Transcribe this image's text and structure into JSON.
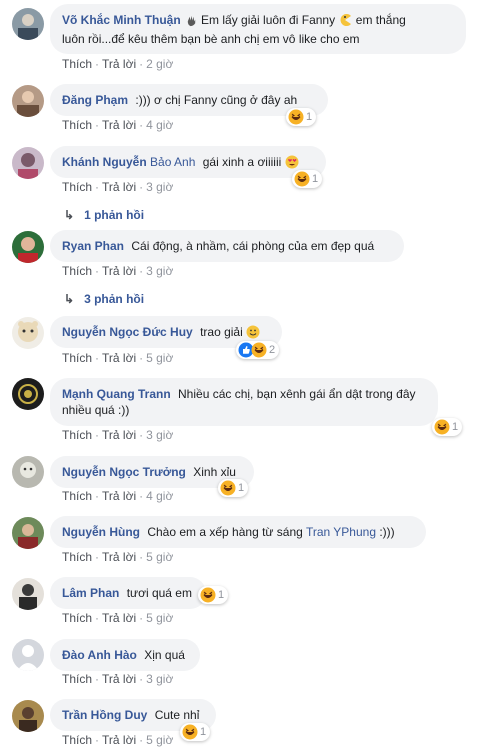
{
  "actions": {
    "like": "Thích",
    "reply": "Trả lời",
    "sep": "·"
  },
  "comments": [
    {
      "author": "Võ Khắc Minh Thuận",
      "text_1": "Em lấy giải luôn đi Fanny",
      "text_2": "em thắng",
      "text_3": "luôn rồi...để kêu thêm bạn bè anh chị em vô like cho em",
      "time": "2 giờ"
    },
    {
      "author": "Đăng Phạm",
      "text": ":))) ơ chị Fanny cũng ở đây ah",
      "time": "4 giờ",
      "reaction_count": "1"
    },
    {
      "author": "Khánh Nguyễn",
      "author_light": "Bảo Anh",
      "text": "gái xinh a ơiiiiii",
      "time": "3 giờ",
      "reaction_count": "1",
      "replies": "1 phản hồi"
    },
    {
      "author": "Ryan Phan",
      "text": "Cái động, à nhầm, cái phòng của em đẹp quá",
      "time": "3 giờ",
      "replies": "3 phản hồi"
    },
    {
      "author": "Nguyễn Ngọc Đức Huy",
      "text": "trao giải",
      "time": "5 giờ",
      "reaction_count": "2"
    },
    {
      "author": "Mạnh Quang Trann",
      "text_1": "Nhiều các chị, bạn xênh gái ẩn dật trong đây",
      "text_2": "nhiều quá :))",
      "time": "3 giờ",
      "reaction_count": "1"
    },
    {
      "author": "Nguyễn Ngọc Trưởng",
      "text": "Xinh xỉu",
      "time": "4 giờ",
      "reaction_count": "1"
    },
    {
      "author": "Nguyễn Hùng",
      "text": "Chào em a xếp hàng từ sáng",
      "mention": "Tran YPhung",
      "text_after": ":)))",
      "time": "5 giờ"
    },
    {
      "author": "Lâm Phan",
      "text": "tươi quá em",
      "time": "5 giờ",
      "reaction_count": "1"
    },
    {
      "author": "Đào Anh Hào",
      "text": "Xịn quá",
      "time": "3 giờ"
    },
    {
      "author": "Trần Hồng Duy",
      "text": "Cute nhỉ",
      "time": "5 giờ",
      "reaction_count": "1"
    }
  ]
}
